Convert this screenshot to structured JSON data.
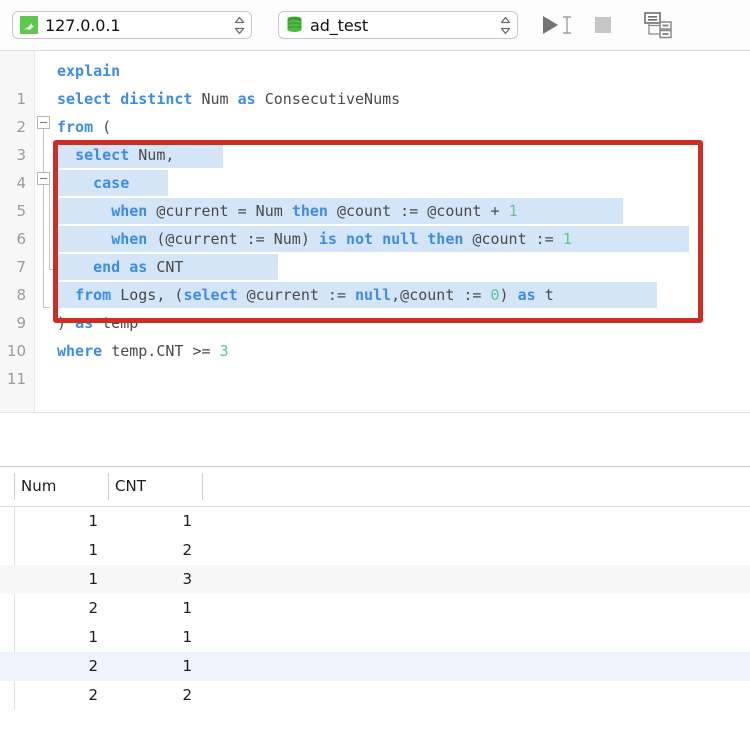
{
  "toolbar": {
    "host": {
      "label": "127.0.0.1",
      "icon": "mysql-dolphin-icon"
    },
    "database": {
      "label": "ad_test",
      "icon": "database-cylinder-icon"
    },
    "run_button": {
      "name": "run-query-button",
      "icon": "play-triangle-icon"
    },
    "stop_button": {
      "name": "stop-query-button",
      "icon": "stop-square-icon"
    },
    "explain_button": {
      "name": "explain-plan-button",
      "icon": "tree-diagram-icon"
    }
  },
  "editor": {
    "language": "sql",
    "colors": {
      "keyword": "#3d8ce8",
      "number": "#5fc88f",
      "plain": "#4a4a4a",
      "selection": "#d4e5f7",
      "gutter_bg": "#f7f7f7",
      "annotation_box": "#cc2f22"
    },
    "line_numbers": [
      "1",
      "2",
      "3",
      "4",
      "5",
      "6",
      "7",
      "8",
      "9",
      "10",
      "11"
    ],
    "lines": [
      {
        "n": "1",
        "text": "explain"
      },
      {
        "n": "2",
        "text": "select distinct Num as ConsecutiveNums"
      },
      {
        "n": "3",
        "text": "from ("
      },
      {
        "n": "4",
        "text": "  select Num,"
      },
      {
        "n": "5",
        "text": "    case"
      },
      {
        "n": "6",
        "text": "      when @current = Num then @count := @count + 1"
      },
      {
        "n": "7",
        "text": "      when (@current := Num) is not null then @count := 1"
      },
      {
        "n": "8",
        "text": "    end as CNT"
      },
      {
        "n": "9",
        "text": "  from Logs, (select @current := null,@count := 0) as t"
      },
      {
        "n": "10",
        "text": ") as temp"
      },
      {
        "n": "11",
        "text": "where temp.CNT >= 3"
      }
    ],
    "selected_lines": [
      "4",
      "5",
      "6",
      "7",
      "8",
      "9"
    ],
    "fold_markers": [
      "3",
      "5"
    ],
    "annotation": {
      "type": "red-rectangle",
      "covers_lines": [
        "4",
        "5",
        "6",
        "7",
        "8",
        "9"
      ]
    }
  },
  "results": {
    "columns": [
      "Num",
      "CNT"
    ],
    "rows": [
      {
        "Num": "1",
        "CNT": "1"
      },
      {
        "Num": "1",
        "CNT": "2"
      },
      {
        "Num": "1",
        "CNT": "3"
      },
      {
        "Num": "2",
        "CNT": "1"
      },
      {
        "Num": "1",
        "CNT": "1"
      },
      {
        "Num": "2",
        "CNT": "1"
      },
      {
        "Num": "2",
        "CNT": "2"
      }
    ],
    "row_styles": [
      "",
      "",
      "alt",
      "",
      "",
      "hl",
      ""
    ]
  }
}
